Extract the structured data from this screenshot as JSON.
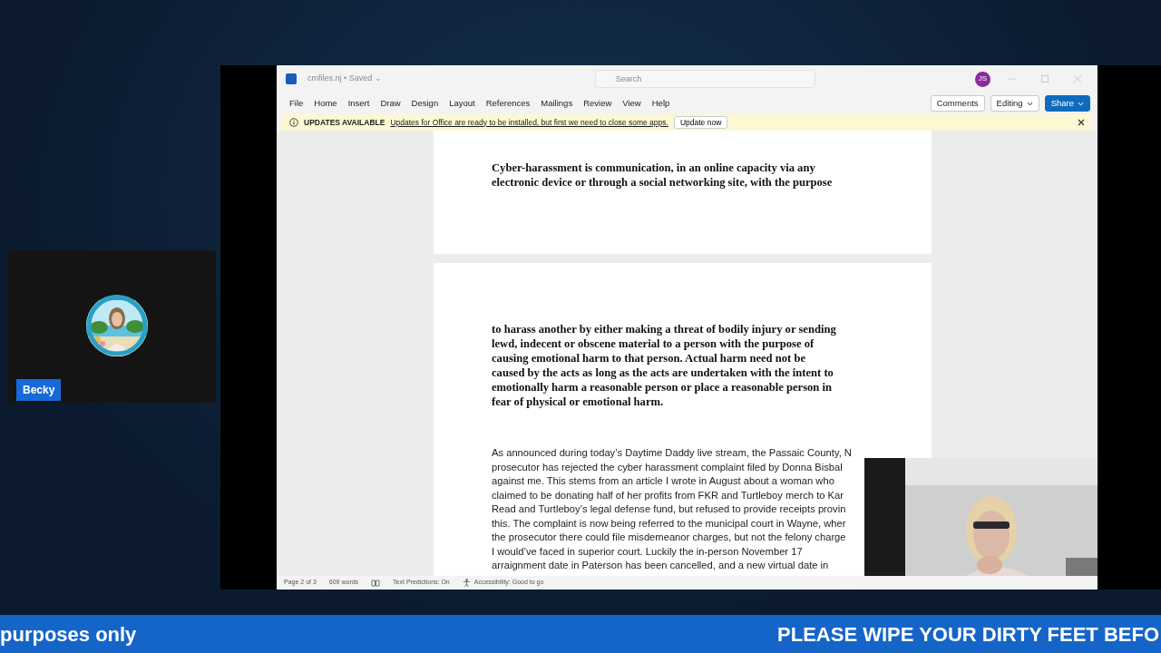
{
  "participant": {
    "name": "Becky"
  },
  "word_window": {
    "title": "cmfiles.nj • Saved ⌄",
    "search": {
      "placeholder": "Search"
    },
    "user_initials": "JS",
    "ribbon_tabs": [
      "File",
      "Home",
      "Insert",
      "Draw",
      "Design",
      "Layout",
      "References",
      "Mailings",
      "Review",
      "View",
      "Help"
    ],
    "ribbon_buttons": [
      {
        "label": "Comments",
        "kind": "plain"
      },
      {
        "label": "Editing",
        "kind": "dropdown"
      },
      {
        "label": "Share",
        "kind": "primary"
      }
    ],
    "update_bar": {
      "title": "UPDATES AVAILABLE",
      "message": "Updates for Office are ready to be installed, but first we need to close some apps.",
      "button": "Update now"
    },
    "pages": [
      {
        "paragraphs": [
          {
            "kind": "legal",
            "lines": [
              "Cyber-harassment is communication, in an online capacity via any",
              "electronic device or through a social networking site, with the purpose"
            ]
          }
        ]
      },
      {
        "paragraphs": [
          {
            "kind": "legal",
            "lines": [
              "to harass another by either making a threat of bodily injury or sending",
              "lewd, indecent or obscene material to a person with the purpose of",
              "causing emotional harm to that person. Actual harm need not be",
              "caused by the acts as long as the acts are undertaken with the intent to",
              "emotionally harm a reasonable person or place a reasonable person in",
              "fear of physical or emotional harm."
            ]
          },
          {
            "kind": "body",
            "lines": [
              "As announced during today’s Daytime Daddy live stream, the Passaic County, N",
              "prosecutor has rejected the cyber harassment complaint filed by Donna Bisbal",
              "against me. This stems from an article I wrote in August about a woman who",
              "claimed to be donating half of her profits from FKR and Turtleboy merch to Kar",
              "Read and Turtleboy’s legal defense fund, but refused to provide receipts provin",
              "this. The complaint is now being referred to the municipal court in Wayne, wher",
              "the prosecutor there could file misdemeanor charges, but not the felony charge",
              "I would’ve faced in superior court. Luckily the in-person November 17",
              "arraignment date in Paterson has been cancelled, and a new virtual date in"
            ]
          }
        ]
      }
    ],
    "status_bar": {
      "page": "Page 2 of 3",
      "words": "609 words",
      "predictions": "Text Predictions: On",
      "accessibility": "Accessibility: Good to go"
    }
  },
  "ticker": [
    "purposes only",
    "PLEASE WIPE YOUR DIRTY FEET BEFO"
  ]
}
